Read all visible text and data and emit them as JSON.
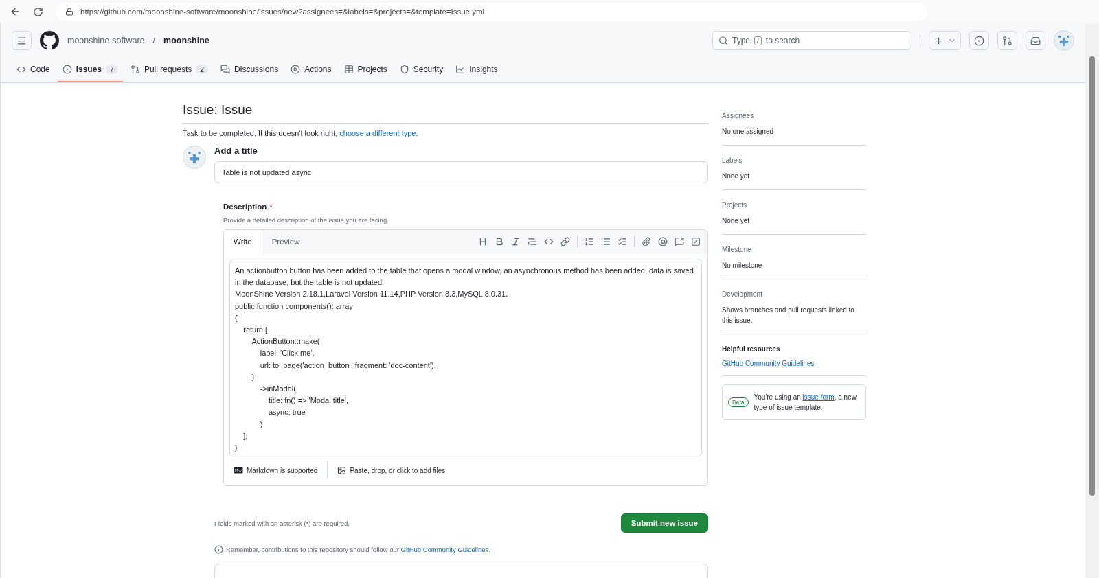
{
  "browser": {
    "url": "https://github.com/moonshine-software/moonshine/issues/new?assignees=&labels=&projects=&template=Issue.yml"
  },
  "header": {
    "owner": "moonshine-software",
    "separator": "/",
    "repo": "moonshine",
    "search": {
      "before": "Type",
      "key": "/",
      "after": "to search"
    }
  },
  "tabs": [
    {
      "label": "Code",
      "selected": false
    },
    {
      "label": "Issues",
      "count": "7",
      "selected": true
    },
    {
      "label": "Pull requests",
      "count": "2",
      "selected": false
    },
    {
      "label": "Discussions",
      "selected": false
    },
    {
      "label": "Actions",
      "selected": false
    },
    {
      "label": "Projects",
      "selected": false
    },
    {
      "label": "Security",
      "selected": false
    },
    {
      "label": "Insights",
      "selected": false
    }
  ],
  "form": {
    "heading": "Issue: Issue",
    "intro": {
      "text": "Task to be completed. If this doesn't look right,",
      "link": "choose a different type",
      "end": "."
    },
    "title_label": "Add a title",
    "title_value": "Table is not updated async",
    "description": {
      "label": "Description",
      "required_mark": "*",
      "hint": "Provide a detailed description of the issue you are facing.",
      "tabs": [
        {
          "label": "Write",
          "selected": true
        },
        {
          "label": "Preview",
          "selected": false
        }
      ],
      "value": "An actionbutton button has been added to the table that opens a modal window, an asynchronous method has been added, data is saved in the database, but the table is not updated.\nMoonShine Version 2.18.1,Laravel Version 11.14,PHP Version 8.3,MySQL 8.0.31.\npublic function components(): array\n{\n    return [\n        ActionButton::make(\n            label: 'Click me',\n            url: to_page('action_button', fragment: 'doc-content'),\n        )\n            ->inModal(\n                title: fn() => 'Modal title',\n                async: true\n            )\n    ];\n}",
      "footer": [
        "Markdown is supported",
        "Paste, drop, or click to add files"
      ]
    },
    "required_note": "Fields marked with an asterisk (*) are required.",
    "submit": "Submit new issue",
    "reminder": {
      "text": "Remember, contributions to this repository should follow our",
      "link": "GitHub Community Guidelines",
      "end": "."
    }
  },
  "sidebar": [
    {
      "title": "Assignees",
      "value": "No one assigned",
      "kind": "text"
    },
    {
      "title": "Labels",
      "value": "None yet",
      "kind": "text"
    },
    {
      "title": "Projects",
      "value": "None yet",
      "kind": "text"
    },
    {
      "title": "Milestone",
      "value": "No milestone",
      "kind": "text"
    },
    {
      "title": "Development",
      "value": "Shows branches and pull requests linked to this issue.",
      "kind": "text"
    },
    {
      "title": "Helpful resources",
      "value": "GitHub Community Guidelines",
      "kind": "link"
    }
  ],
  "beta_note": {
    "badge": "Beta",
    "before": "You're using an",
    "link": "issue form",
    "after": ", a new type of issue template."
  }
}
